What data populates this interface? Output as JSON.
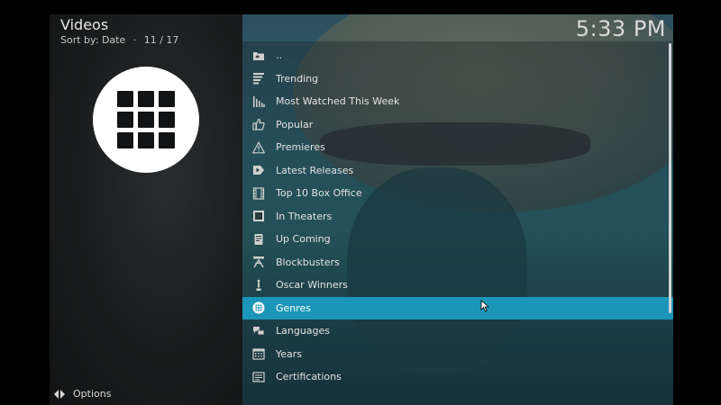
{
  "header": {
    "title": "Videos",
    "sort_label": "Sort by: Date",
    "separator": "·",
    "position": "11 / 17"
  },
  "clock": "5:33 PM",
  "thumbnail": {
    "icon": "grid-icon"
  },
  "list": {
    "items": [
      {
        "label": "..",
        "icon": "folder-back-icon",
        "active": false
      },
      {
        "label": "Trending",
        "icon": "trending-icon",
        "active": false
      },
      {
        "label": "Most Watched This Week",
        "icon": "bar-chart-icon",
        "active": false
      },
      {
        "label": "Popular",
        "icon": "thumbs-up-icon",
        "active": false
      },
      {
        "label": "Premieres",
        "icon": "warning-icon",
        "active": false
      },
      {
        "label": "Latest Releases",
        "icon": "video-tag-icon",
        "active": false
      },
      {
        "label": "Top 10 Box Office",
        "icon": "film-icon",
        "active": false
      },
      {
        "label": "In Theaters",
        "icon": "screen-icon",
        "active": false
      },
      {
        "label": "Up Coming",
        "icon": "calendar-page-icon",
        "active": false
      },
      {
        "label": "Blockbusters",
        "icon": "blockbuster-icon",
        "active": false
      },
      {
        "label": "Oscar Winners",
        "icon": "oscar-icon",
        "active": false
      },
      {
        "label": "Genres",
        "icon": "grid-icon",
        "active": true
      },
      {
        "label": "Languages",
        "icon": "languages-icon",
        "active": false
      },
      {
        "label": "Years",
        "icon": "calendar-icon",
        "active": false
      },
      {
        "label": "Certifications",
        "icon": "certificate-icon",
        "active": false
      }
    ]
  },
  "footer": {
    "options_label": "Options",
    "icon": "options-arrows-icon"
  },
  "colors": {
    "accent": "#1c96b8"
  }
}
